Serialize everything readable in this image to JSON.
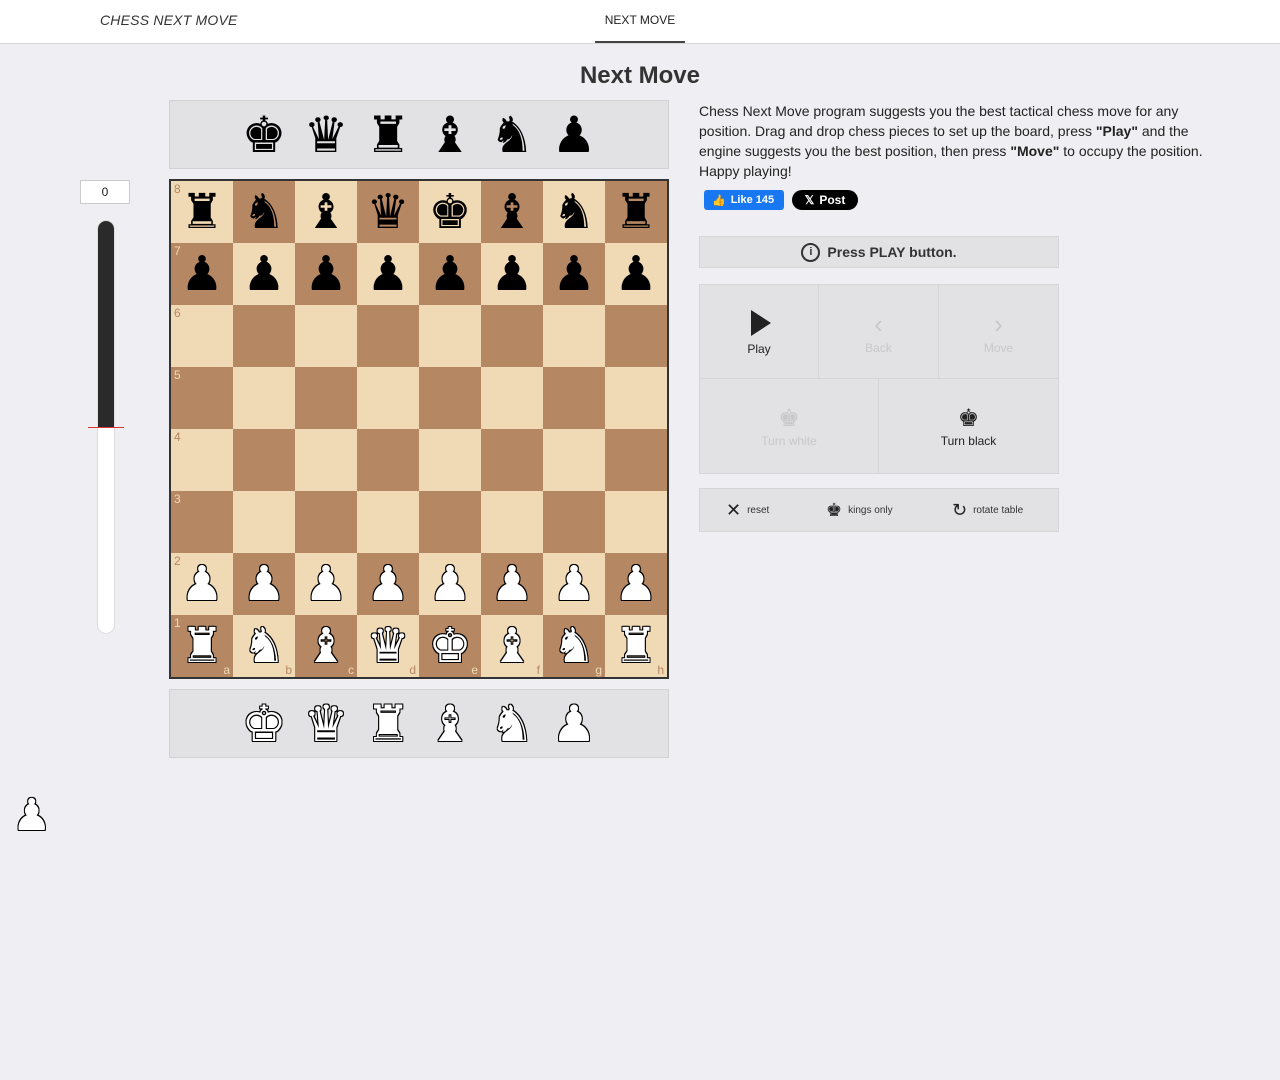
{
  "header": {
    "brand": "CHESS NEXT MOVE",
    "active_tab": "NEXT MOVE"
  },
  "page_title": "Next Move",
  "eval": {
    "score": "0",
    "black_share": 0.5
  },
  "tray_top": [
    "♚",
    "♛",
    "♜",
    "♝",
    "♞",
    "♟"
  ],
  "tray_bottom": [
    "♚",
    "♛",
    "♜",
    "♝",
    "♞",
    "♟"
  ],
  "tray_names": [
    "king",
    "queen",
    "rook",
    "bishop",
    "knight",
    "pawn"
  ],
  "board": {
    "ranks": [
      "8",
      "7",
      "6",
      "5",
      "4",
      "3",
      "2",
      "1"
    ],
    "files": [
      "a",
      "b",
      "c",
      "d",
      "e",
      "f",
      "g",
      "h"
    ],
    "rows": [
      [
        "br",
        "bn",
        "bb",
        "bq",
        "bk",
        "bb",
        "bn",
        "br"
      ],
      [
        "bp",
        "bp",
        "bp",
        "bp",
        "bp",
        "bp",
        "bp",
        "bp"
      ],
      [
        "",
        "",
        "",
        "",
        "",
        "",
        "",
        ""
      ],
      [
        "",
        "",
        "",
        "",
        "",
        "",
        "",
        ""
      ],
      [
        "",
        "",
        "",
        "",
        "",
        "",
        "",
        ""
      ],
      [
        "",
        "",
        "",
        "",
        "",
        "",
        "",
        ""
      ],
      [
        "wp",
        "wp",
        "wp",
        "wp",
        "wp",
        "wp",
        "wp",
        "wp"
      ],
      [
        "wr",
        "wn",
        "wb",
        "wq",
        "wk",
        "wb",
        "wn",
        "wr"
      ]
    ]
  },
  "description": {
    "part1": "Chess Next Move program suggests you the best tactical chess move for any position. Drag and drop chess pieces to set up the board, press ",
    "play_word": "\"Play\"",
    "part2": " and the engine suggests you the best position, then press ",
    "move_word": "\"Move\"",
    "part3": " to occupy the position. Happy playing!"
  },
  "social": {
    "like_label": "Like 145",
    "post_label": "Post"
  },
  "status": "Press PLAY button.",
  "controls": {
    "play": "Play",
    "back": "Back",
    "move": "Move",
    "turn_white": "Turn white",
    "turn_black": "Turn black"
  },
  "tools": {
    "reset": "reset",
    "kings_only": "kings only",
    "rotate": "rotate table"
  },
  "colors": {
    "light_square": "#f0d9b5",
    "dark_square": "#b58863",
    "facebook": "#1877f2"
  },
  "icons": {
    "info": "info-icon",
    "play": "play-icon",
    "back": "chevron-left-icon",
    "move": "chevron-right-icon",
    "reset": "close-icon",
    "kings": "king-icon",
    "rotate": "rotate-icon"
  }
}
